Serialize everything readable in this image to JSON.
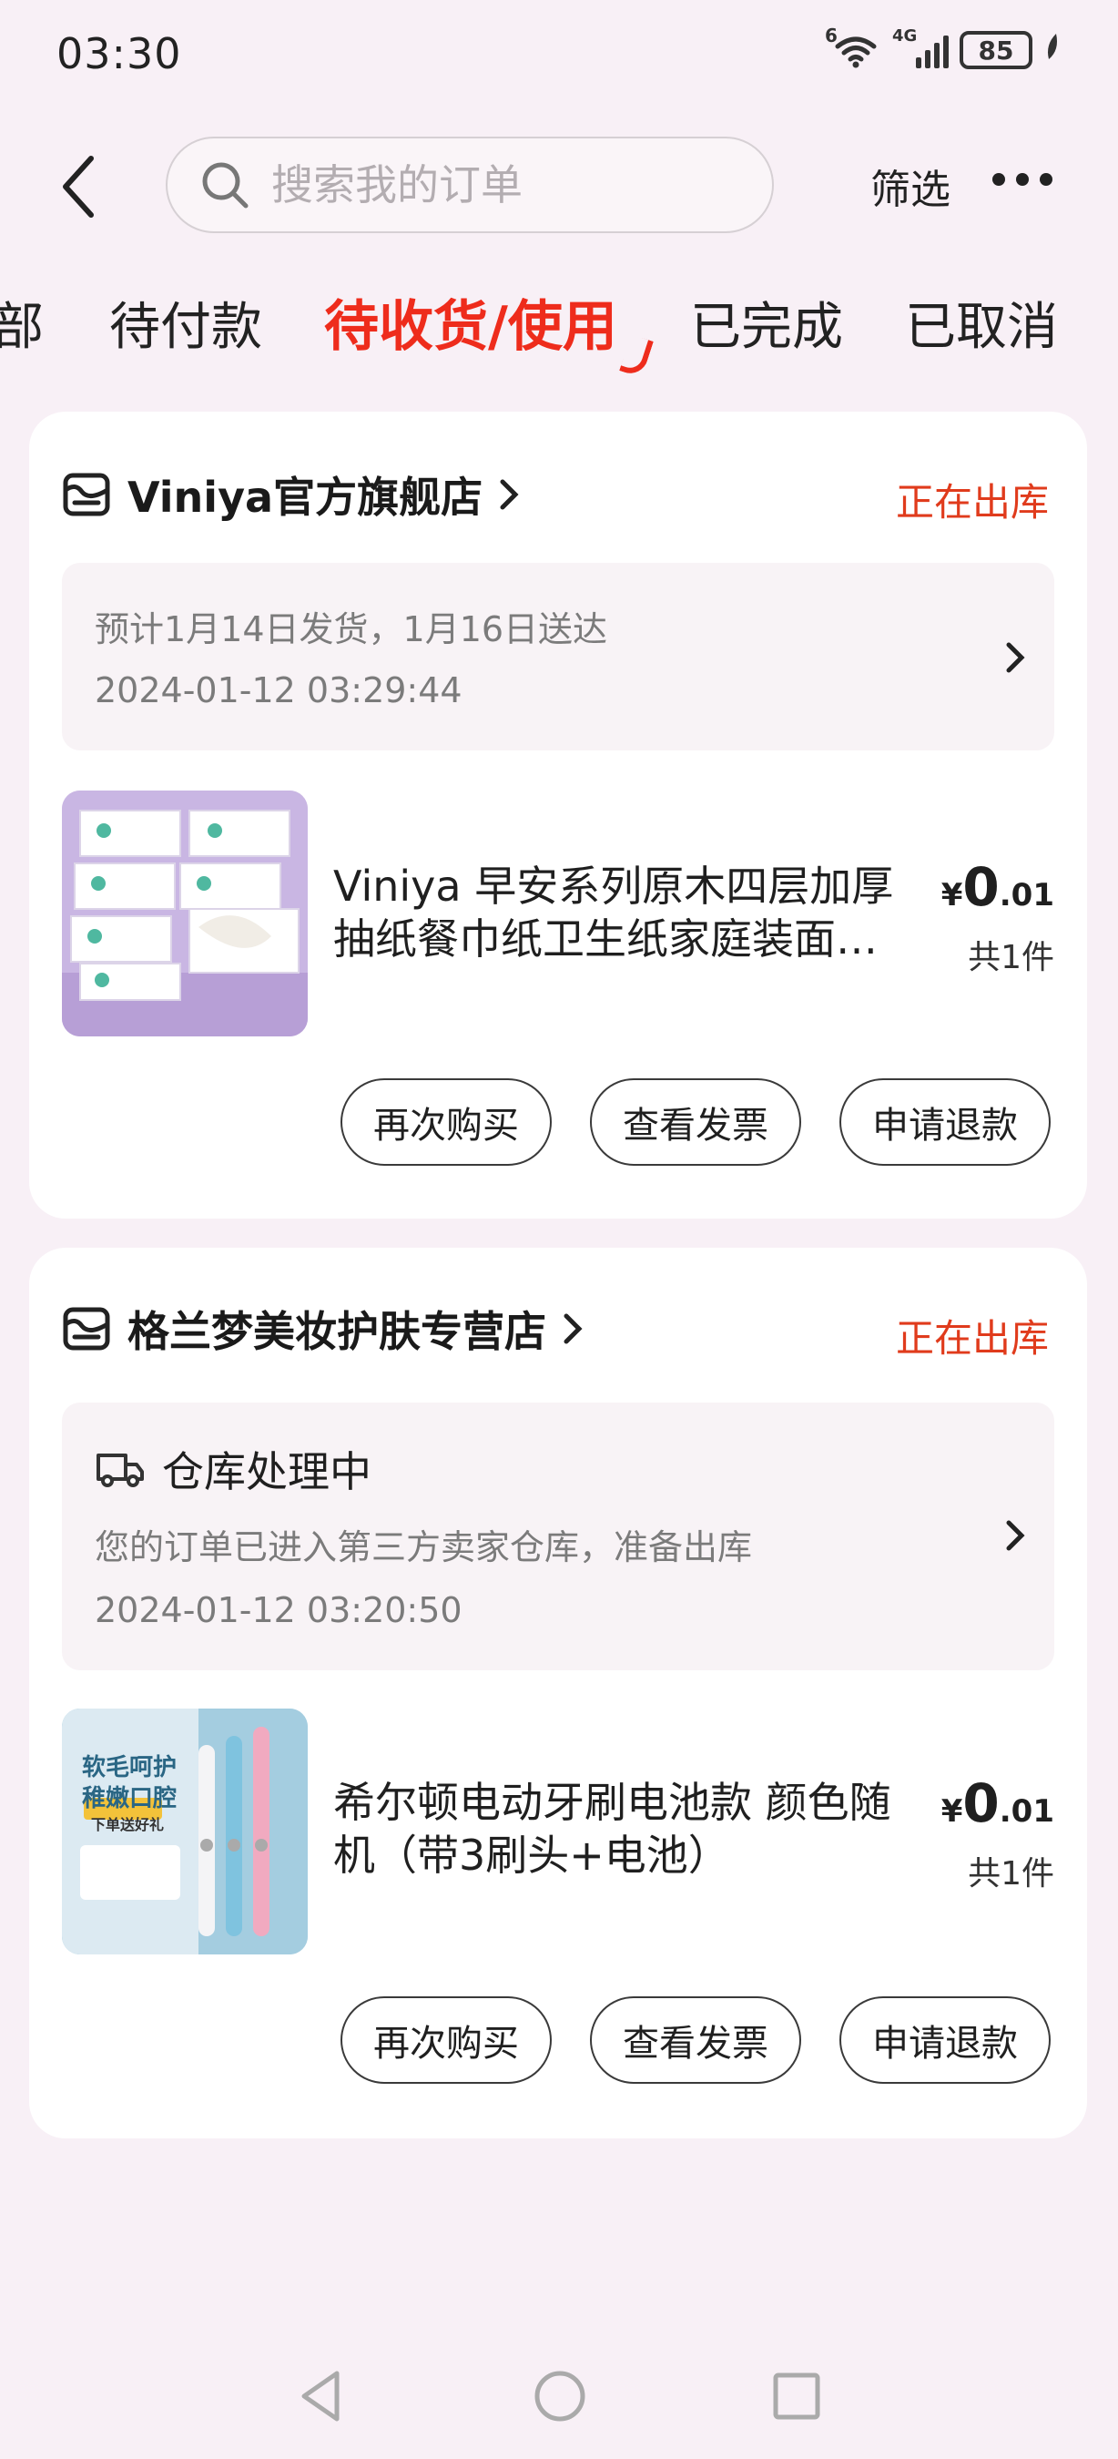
{
  "status_bar": {
    "time": "03:30",
    "wifi_badge": "6",
    "network": "4G",
    "battery": "85"
  },
  "header": {
    "search_placeholder": "搜索我的订单",
    "filter_label": "筛选"
  },
  "tabs": [
    {
      "label": "部",
      "active": false
    },
    {
      "label": "待付款",
      "active": false
    },
    {
      "label": "待收货/使用",
      "active": true
    },
    {
      "label": "已完成",
      "active": false
    },
    {
      "label": "已取消",
      "active": false
    }
  ],
  "orders": [
    {
      "store_name": "Viniya官方旗舰店",
      "status": "正在出库",
      "shipping": {
        "title": "",
        "line1": "预计1月14日发货，1月16日送达",
        "timestamp": "2024-01-12 03:29:44"
      },
      "product": {
        "title": "Viniya 早安系列原木四层加厚抽纸餐巾纸卫生纸家庭装面巾纸",
        "price_symbol": "¥",
        "price_int": "0",
        "price_dec": ".01",
        "qty": "共1件"
      },
      "buttons": [
        "再次购买",
        "查看发票",
        "申请退款"
      ]
    },
    {
      "store_name": "格兰梦美妆护肤专营店",
      "status": "正在出库",
      "shipping": {
        "title": "仓库处理中",
        "line1": "您的订单已进入第三方卖家仓库，准备出库",
        "timestamp": "2024-01-12 03:20:50"
      },
      "product": {
        "title": "希尔顿电动牙刷电池款 颜色随机（带3刷头+电池）",
        "price_symbol": "¥",
        "price_int": "0",
        "price_dec": ".01",
        "qty": "共1件",
        "image_text_1": "软毛呵护",
        "image_text_2": "稚嫩口腔",
        "image_text_3": "下单送好礼"
      },
      "buttons": [
        "再次购买",
        "查看发票",
        "申请退款"
      ]
    }
  ],
  "colors": {
    "accent": "#ee2c1c",
    "status": "#e03b1c",
    "background": "#f8f0f6"
  }
}
